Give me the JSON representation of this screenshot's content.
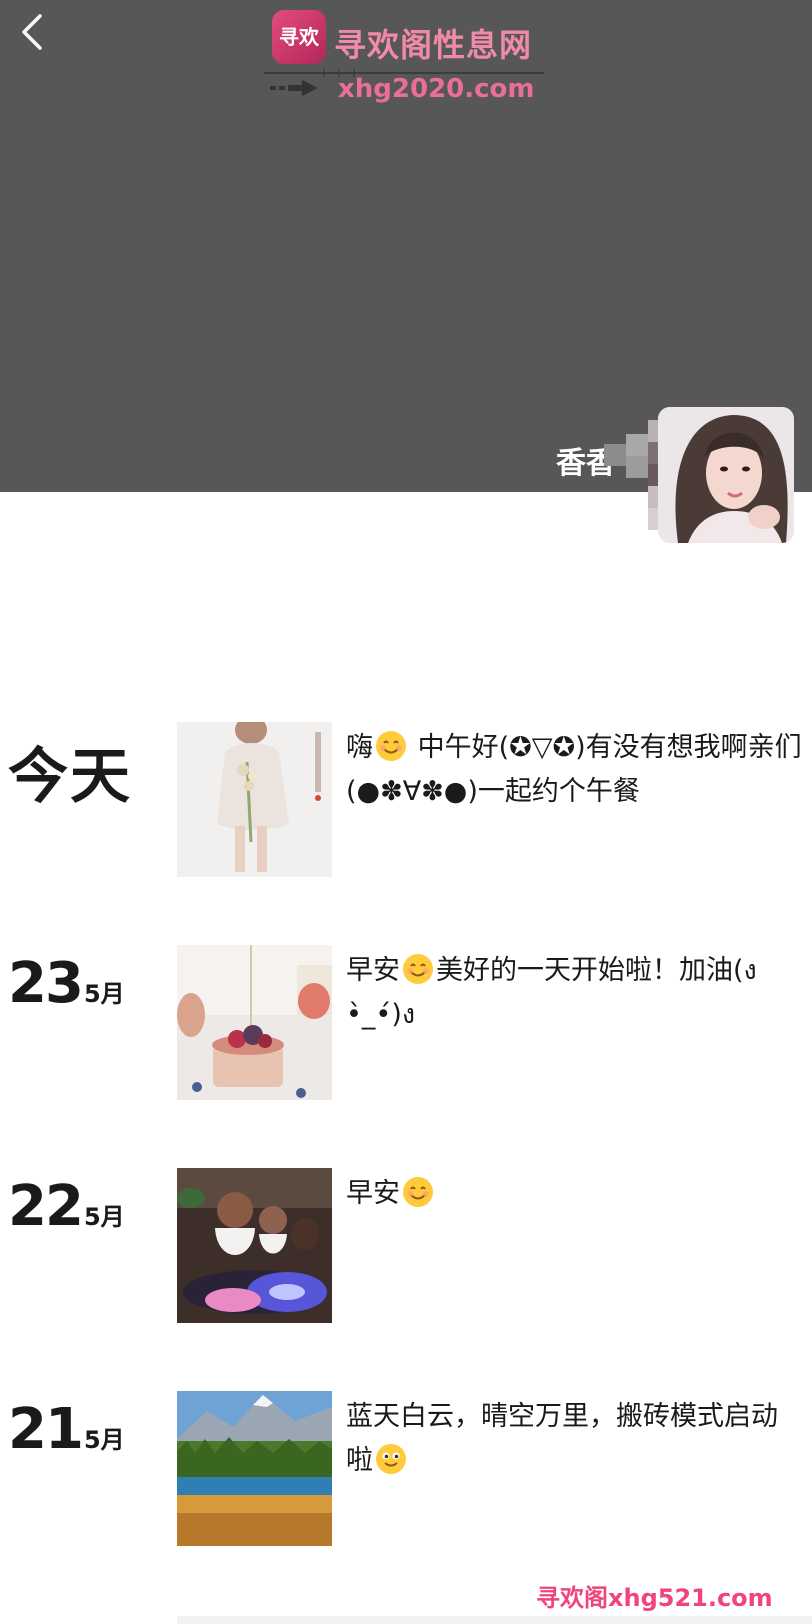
{
  "header": {
    "back_icon": "chevron-left-icon",
    "nickname": "香香",
    "cover_color": "#575757"
  },
  "watermark_top": {
    "logo_text": "寻欢",
    "title": "寻欢阁性息网",
    "url": "xhg2020.com"
  },
  "posts": [
    {
      "date_label": "今天",
      "text": "中午好(✪▽✪)有没有想我啊亲们(●✽∀✽●)一起约个午餐",
      "prefix": "嗨",
      "image_icon": "girl-with-flowers-photo"
    },
    {
      "day": "23",
      "month": "5月",
      "prefix": "早安",
      "text": "美好的一天开始啦！加油(ง •̀_•́)ง",
      "image_icon": "cake-photo"
    },
    {
      "day": "22",
      "month": "5月",
      "prefix": "早安",
      "text": "",
      "image_icon": "monk-figurines-photo"
    },
    {
      "day": "21",
      "month": "5月",
      "prefix": "蓝天白云，晴空万里，搬砖模式启动啦",
      "text": "",
      "image_icon": "mountain-lake-photo"
    }
  ],
  "watermark_bottom": {
    "text": "寻欢阁xhg521.com"
  }
}
